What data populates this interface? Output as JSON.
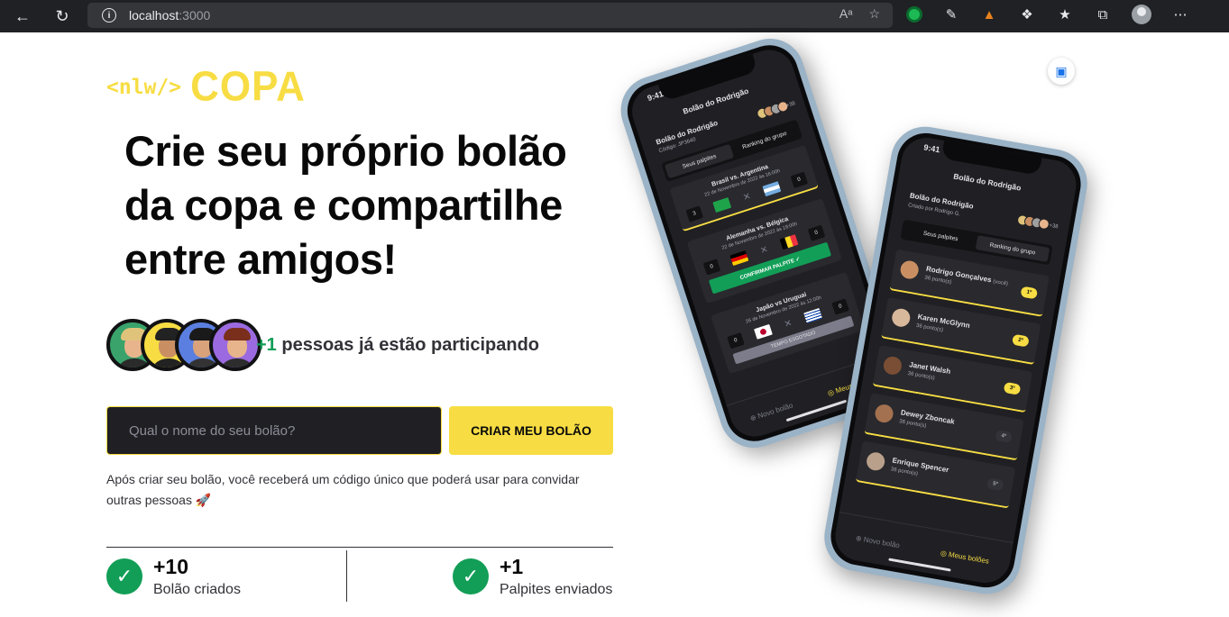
{
  "browser": {
    "host": "localhost",
    "port": ":3000"
  },
  "logo": {
    "tag": "<nlw/>",
    "name": "COPA"
  },
  "headline": "Crie seu próprio bolão da copa e compartilhe entre amigos!",
  "participants": {
    "plus": "+1",
    "text": " pessoas já estão participando"
  },
  "form": {
    "placeholder": "Qual o nome do seu bolão?",
    "button": "CRIAR MEU BOLÃO"
  },
  "info": "Após criar seu bolão, você receberá um código único que poderá usar para convidar outras pessoas 🚀",
  "stats": [
    {
      "value": "+10",
      "label": "Bolão criados"
    },
    {
      "value": "+1",
      "label": "Palpites enviados"
    }
  ],
  "colors": {
    "brand_yellow": "#f7dd43",
    "success_green": "#129e57",
    "dark": "#202024"
  },
  "phone_back": {
    "time": "9:41",
    "title": "Bolão do Rodrigão",
    "pool_name": "Bolão do Rodrigão",
    "pool_code": "Código: JP3640",
    "more": "+38",
    "tabs": [
      "Seus palpites",
      "Ranking do grupo"
    ],
    "games": [
      {
        "title": "Brasil vs. Argentina",
        "date": "22 de Novembro de 2022 às 16:00h",
        "home_score": "3",
        "away_score": "0"
      },
      {
        "title": "Alemanha vs. Bélgica",
        "date": "22 de Novembro de 2022 às 19:00h",
        "home_score": "0",
        "away_score": "0",
        "action": "CONFIRMAR PALPITE ✓"
      },
      {
        "title": "Japão vs Uruguai",
        "date": "26 de Novembro de 2022 às 12:00h",
        "home_score": "0",
        "away_score": "0",
        "action": "TEMPO ESGOTADO"
      }
    ],
    "nav": [
      "⊕ Novo bolão",
      "◎ Meus bolões"
    ]
  },
  "phone_front": {
    "time": "9:41",
    "title": "Bolão do Rodrigão",
    "pool_name": "Bolão do Rodrigão",
    "pool_owner": "Criado por Rodrigo G.",
    "more": "+38",
    "tabs": [
      "Seus palpites",
      "Ranking do grupo"
    ],
    "ranking": [
      {
        "name": "Rodrigo Gonçalves",
        "you": "(você)",
        "points": "36 ponto(s)",
        "pos": "1º"
      },
      {
        "name": "Karen McGlynn",
        "you": "",
        "points": "36 ponto(s)",
        "pos": "2º"
      },
      {
        "name": "Janet Walsh",
        "you": "",
        "points": "36 ponto(s)",
        "pos": "3º"
      },
      {
        "name": "Dewey Zboncak",
        "you": "",
        "points": "36 ponto(s)",
        "pos": "4º"
      },
      {
        "name": "Enrique Spencer",
        "you": "",
        "points": "36 ponto(s)",
        "pos": "5º"
      }
    ],
    "nav": [
      "⊕ Novo bolão",
      "◎ Meus bolões"
    ]
  }
}
